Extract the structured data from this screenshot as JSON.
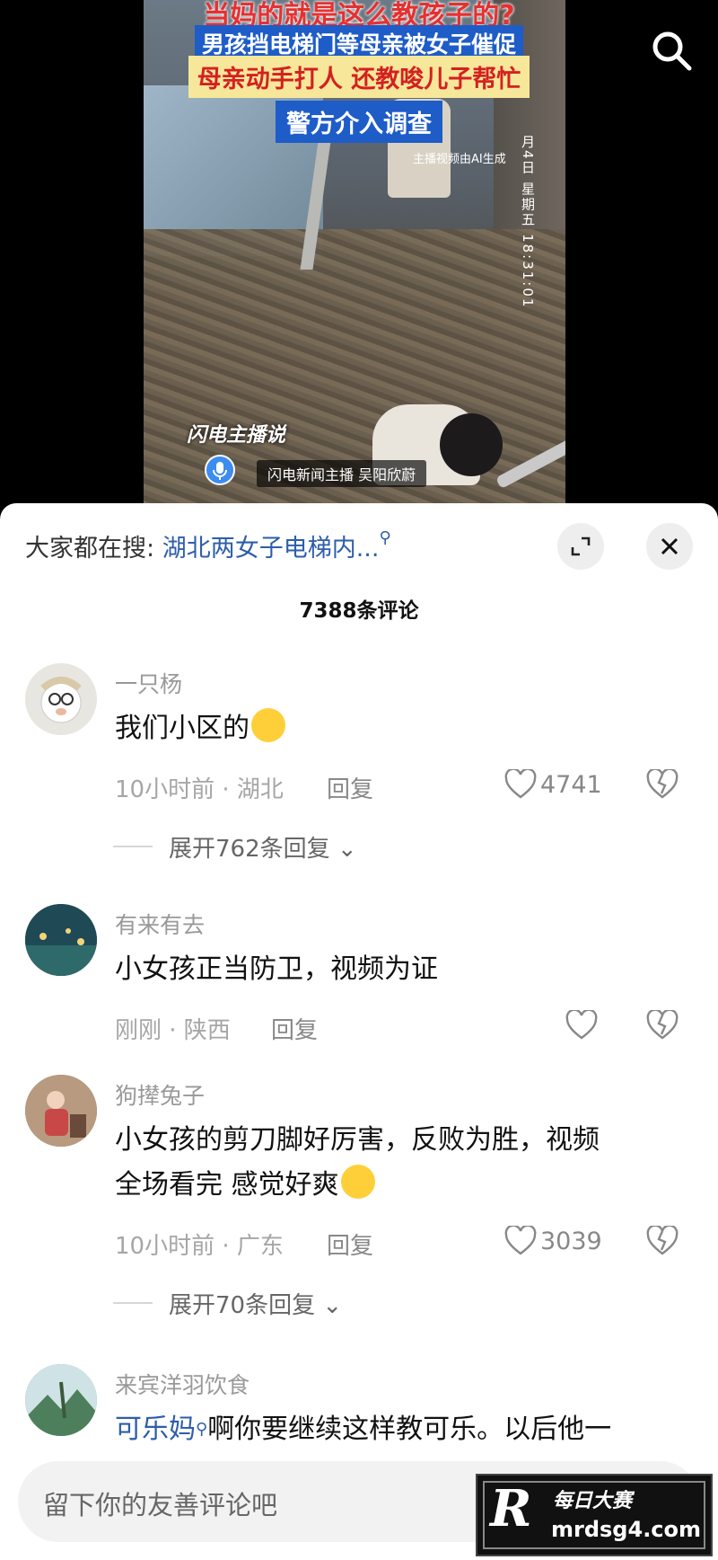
{
  "video": {
    "headline_1": "当妈的就是这么教孩子的?",
    "headline_2": "男孩挡电梯门等母亲被女子催促",
    "headline_3": "母亲动手打人 还教唆儿子帮忙",
    "headline_4": "警方介入调查",
    "ai_note": "主播视频由AI生成",
    "timestamp": "月4日 星期五 18:31:01",
    "logo_text": "闪电主播说",
    "anchor_label": "闪电新闻主播 吴阳欣蔚"
  },
  "sheet": {
    "search_prefix": "大家都在搜:",
    "search_query": "湖北两女子电梯内...",
    "comment_count": "7388条评论"
  },
  "comments": [
    {
      "username": "一只杨",
      "text": "我们小区的",
      "time": "10小时前 · 湖北",
      "reply": "回复",
      "likes": "4741",
      "expand": "展开762条回复",
      "avatar_color": "#e8e6e1"
    },
    {
      "username": "有来有去",
      "text": "小女孩正当防卫，视频为证",
      "time": "刚刚 · 陕西",
      "reply": "回复",
      "likes": "",
      "expand": "",
      "avatar_color": "#1f4a55"
    },
    {
      "username": "狗撵兔子",
      "text_line1": "小女孩的剪刀脚好厉害，反败为胜，视频",
      "text_line2": "全场看完 感觉好爽",
      "time": "10小时前 · 广东",
      "reply": "回复",
      "likes": "3039",
      "expand": "展开70条回复",
      "avatar_color": "#8a6a55"
    },
    {
      "username": "来宾洋羽饮食",
      "mention": "可乐妈",
      "text": "啊你要继续这样教可乐。以后他一",
      "avatar_color": "#5c8c6a"
    }
  ],
  "input": {
    "placeholder": "留下你的友善评论吧"
  },
  "watermark": {
    "line1": "每日大赛",
    "line2": "mrdsg4.com",
    "letter": "R"
  },
  "colors": {
    "link": "#2d5ea9",
    "meta": "#a6a6a6",
    "sheet_bg": "#ffffff"
  },
  "icons": [
    "search-icon",
    "expand-icon",
    "close-icon",
    "heart-icon",
    "broken-heart-icon",
    "chevron-down-icon",
    "mic-icon"
  ]
}
